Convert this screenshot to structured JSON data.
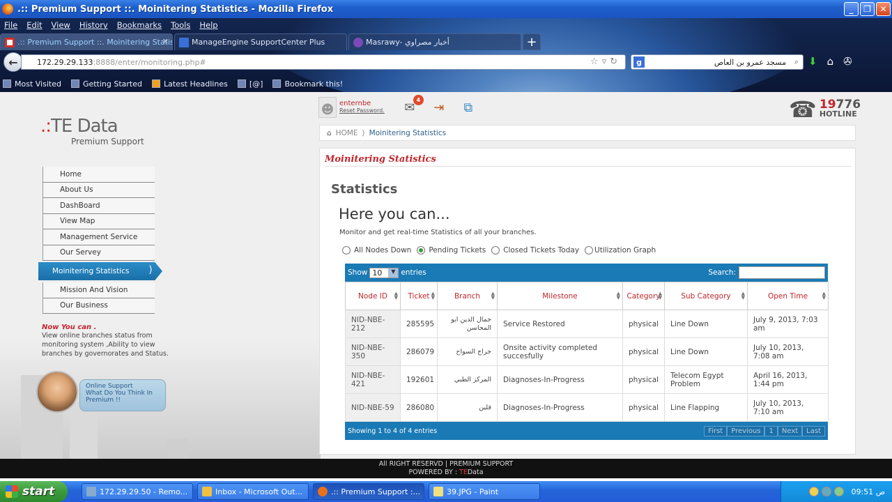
{
  "window": {
    "title": ".:: Premium Support ::. Moinitering Statistics - Mozilla Firefox"
  },
  "menu": [
    "File",
    "Edit",
    "View",
    "History",
    "Bookmarks",
    "Tools",
    "Help"
  ],
  "tabs": [
    {
      "label": ".:: Premium Support ::. Moinitering Statis..."
    },
    {
      "label": "ManageEngine SupportCenter Plus"
    },
    {
      "label": "Masrawy- أخبار مصراوي"
    }
  ],
  "nav": {
    "url_host": "172.29.29.133",
    "url_rest": ":8888/enter/monitoring.php#",
    "search_query": "مسجد عمرو بن العاص"
  },
  "bookmarks": [
    "Most Visited",
    "Getting Started",
    "Latest Headlines",
    "[@]",
    "Bookmark this!"
  ],
  "site": {
    "logo_main": "TE Data",
    "logo_sub": "Premium Support",
    "user": {
      "name": "enternbe",
      "reset": "Reset Password."
    },
    "notif_count": "4",
    "hotline_num_red": "19",
    "hotline_num": "776",
    "hotline_label": "HOTLINE",
    "breadcrumb": {
      "home": "HOME",
      "current": "Moinitering Statistics"
    },
    "nav": [
      "Home",
      "About Us",
      "DashBoard",
      "View Map",
      "Management Service",
      "Our Servey",
      "Moinitering Statistics",
      "Mission And Vision",
      "Our Business"
    ],
    "nowyou": {
      "heading": "Now You can .",
      "text": "View online branches status from monitoring system ,Ability to view branches by governorates and Status."
    },
    "support": {
      "l1": "Online Support",
      "l2": "What Do You Think In",
      "l3": "Premium !!"
    }
  },
  "panel": {
    "title": "Moinitering Statistics",
    "heading": "Statistics",
    "here": "Here you can...",
    "monitor": "Monitor and get real-time Statistics of all your branches.",
    "radios": [
      {
        "label": "All Nodes Down",
        "checked": false
      },
      {
        "label": "Pending Tickets",
        "checked": true
      },
      {
        "label": "Closed Tickets Today",
        "checked": false
      },
      {
        "label": "Utilization Graph",
        "checked": false
      }
    ]
  },
  "table": {
    "show": "Show",
    "show_val": "10",
    "entries": "entries",
    "search": "Search:",
    "columns": [
      "Node ID",
      "Ticket",
      "Branch",
      "Milestone",
      "Category",
      "Sub Category",
      "Open Time"
    ],
    "rows": [
      [
        "NID-NBE-212",
        "285595",
        "جمال الدين ابو المحاسن",
        "Service Restored",
        "physical",
        "Line Down",
        "July 9, 2013, 7:03 am"
      ],
      [
        "NID-NBE-350",
        "286079",
        "جراج السواح",
        "Onsite activity completed succesfully",
        "physical",
        "Line Down",
        "July 10, 2013, 7:08 am"
      ],
      [
        "NID-NBE-421",
        "192601",
        "المركز الطبي",
        "Diagnoses-In-Progress",
        "physical",
        "Telecom Egypt Problem",
        "April 16, 2013, 1:44 pm"
      ],
      [
        "NID-NBE-59",
        "286080",
        "قلين",
        "Diagnoses-In-Progress",
        "physical",
        "Line Flapping",
        "July 10, 2013, 7:10 am"
      ]
    ],
    "info": "Showing 1 to 4 of 4 entries",
    "pager": [
      "First",
      "Previous",
      "1",
      "Next",
      "Last"
    ]
  },
  "footer": {
    "line1": "All RIGHT RESERVD | PREMIUM SUPPORT",
    "line2a": "POWERED BY : ",
    "line2b": "TE",
    "line2c": "Data"
  },
  "taskbar": {
    "start": "start",
    "items": [
      "172.29.29.50 - Remo...",
      "Inbox - Microsoft Out...",
      ".:: Premium Support :...",
      "39.JPG - Paint"
    ],
    "clock": "09:51 ص"
  }
}
